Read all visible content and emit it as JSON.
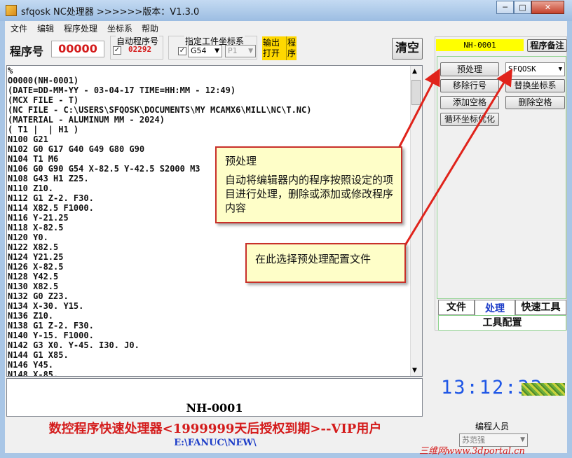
{
  "window": {
    "title": "sfqosk NC处理器  >>>>>>版本：V1.3.0",
    "controls": [
      "─",
      "□",
      "✕"
    ]
  },
  "menu": [
    "文件",
    "编辑",
    "程序处理",
    "坐标系",
    "帮助"
  ],
  "toolbar": {
    "program_no_label": "程序号",
    "program_no_value": "00000",
    "auto_program_label": "自动程序号",
    "auto_program_value": "02292",
    "wcs_label": "指定工件坐标系",
    "wcs_value": "G54",
    "wcs_sub_value": "P1",
    "output_open": "输出\n打开",
    "program": "程\n序",
    "clear": "清空"
  },
  "code_lines": [
    "%",
    "O0000(NH-0001)",
    "(DATE=DD-MM-YY - 03-04-17 TIME=HH:MM - 12:49)",
    "(MCX FILE - T)",
    "(NC FILE - C:\\USERS\\SFQOSK\\DOCUMENTS\\MY MCAMX6\\MILL\\NC\\T.NC)",
    "(MATERIAL - ALUMINUM MM - 2024)",
    "( T1 |  | H1 )",
    "N100 G21",
    "N102 G0 G17 G40 G49 G80 G90",
    "N104 T1 M6",
    "N106 G0 G90 G54 X-82.5 Y-42.5 S2000 M3",
    "N108 G43 H1 Z25.",
    "N110 Z10.",
    "N112 G1 Z-2. F30.",
    "N114 X82.5 F1000.",
    "N116 Y-21.25",
    "N118 X-82.5",
    "N120 Y0.",
    "N122 X82.5",
    "N124 Y21.25",
    "N126 X-82.5",
    "N128 Y42.5",
    "N130 X82.5",
    "N132 G0 Z23.",
    "N134 X-30. Y15.",
    "N136 Z10.",
    "N138 G1 Z-2. F30.",
    "N140 Y-15. F1000.",
    "N142 G3 X0. Y-45. I30. J0.",
    "N144 G1 X85.",
    "N146 Y45.",
    "N148 X-85."
  ],
  "program_name": "NH-0001",
  "banner": "数控程序快速处理器<1999999天后授权到期>--VIP用户",
  "path": "E:\\FANUC\\NEW\\",
  "right_panel": {
    "program_id": "NH-0001",
    "remark_btn": "程序备注",
    "preprocess_btn": "预处理",
    "profile_value": "SFQOSK",
    "remove_line_no": "移除行号",
    "replace_wcs": "替换坐标系",
    "add_space": "添加空格",
    "delete_space": "删除空格",
    "loop_coord_opt": "循环坐标优化",
    "tabs": [
      "文件",
      "处理",
      "快速工具"
    ],
    "tool_config": "工具配置",
    "clock": "13:12:33",
    "programmer_label": "编程人员",
    "programmer_value": "苏范强"
  },
  "callout1": {
    "title": "预处理",
    "body": "自动将编辑器内的程序按照设定的项目进行处理，删除或添加或修改程序内容"
  },
  "callout2": {
    "body": "在此选择预处理配置文件"
  },
  "watermark": "三维网www.3dportal.cn",
  "colors": {
    "title_bg": "#b7d0ec",
    "red": "#d41b1b",
    "blue": "#1e3ec8",
    "clock": "#1e56e6",
    "highlight": "#ffff00"
  }
}
